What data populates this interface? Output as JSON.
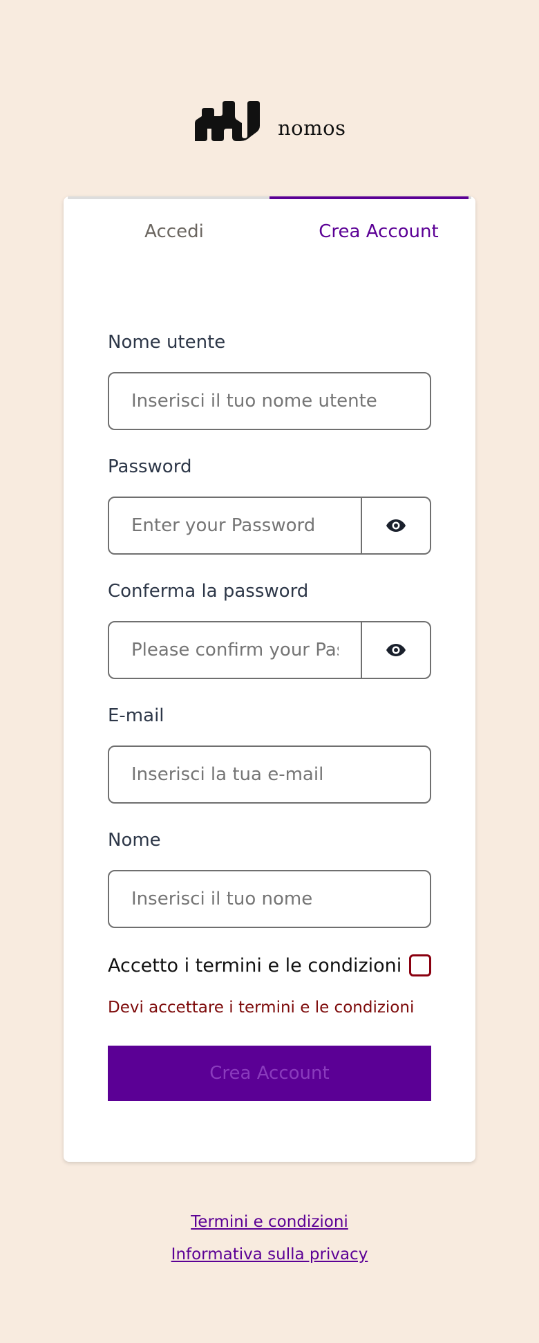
{
  "brand": {
    "name": "nomos",
    "logo_icon": "nomos-logo-icon"
  },
  "tabs": {
    "login_label": "Accedi",
    "create_label": "Crea Account",
    "active": "create"
  },
  "form": {
    "username": {
      "label": "Nome utente",
      "placeholder": "Inserisci il tuo nome utente",
      "value": ""
    },
    "password": {
      "label": "Password",
      "placeholder": "Enter your Password",
      "value": "",
      "toggle_icon": "eye-icon"
    },
    "confirm_password": {
      "label": "Conferma la password",
      "placeholder": "Please confirm your Password",
      "value": "",
      "toggle_icon": "eye-icon"
    },
    "email": {
      "label": "E-mail",
      "placeholder": "Inserisci la tua e-mail",
      "value": ""
    },
    "name": {
      "label": "Nome",
      "placeholder": "Inserisci il tuo nome",
      "value": ""
    },
    "terms": {
      "label": "Accetto i termini e le condizioni",
      "checked": false,
      "error": "Devi accettare i termini e le condizioni"
    },
    "submit_label": "Crea Account"
  },
  "footer": {
    "terms_link": "Termini e condizioni",
    "privacy_link": "Informativa sulla privacy"
  },
  "colors": {
    "background": "#f8ebdf",
    "accent": "#5b0095",
    "error": "#7d0a0a"
  }
}
